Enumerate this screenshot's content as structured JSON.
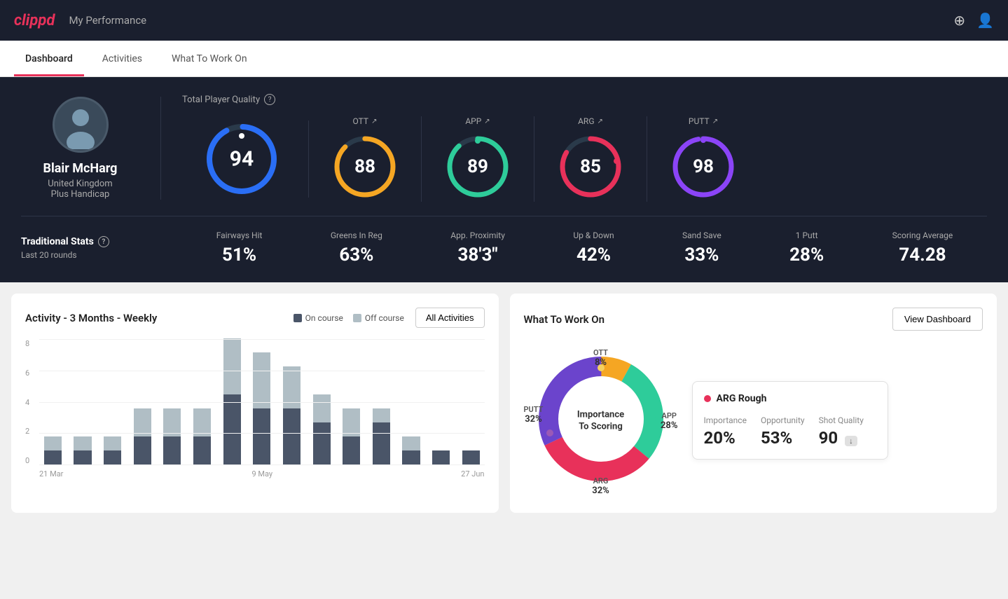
{
  "header": {
    "logo": "clippd",
    "title": "My Performance",
    "add_icon": "⊕",
    "user_icon": "👤"
  },
  "nav": {
    "tabs": [
      "Dashboard",
      "Activities",
      "What To Work On"
    ],
    "active": 0
  },
  "player": {
    "name": "Blair McHarg",
    "country": "United Kingdom",
    "handicap": "Plus Handicap"
  },
  "quality": {
    "label": "Total Player Quality",
    "main": {
      "value": "94"
    },
    "metrics": [
      {
        "id": "ott",
        "label": "OTT",
        "value": "88",
        "color": "#f5a623"
      },
      {
        "id": "app",
        "label": "APP",
        "value": "89",
        "color": "#2ecc9a"
      },
      {
        "id": "arg",
        "label": "ARG",
        "value": "85",
        "color": "#e8315a"
      },
      {
        "id": "putt",
        "label": "PUTT",
        "value": "98",
        "color": "#8b44f7"
      }
    ]
  },
  "traditional_stats": {
    "title": "Traditional Stats",
    "subtitle": "Last 20 rounds",
    "items": [
      {
        "label": "Fairways Hit",
        "value": "51%"
      },
      {
        "label": "Greens In Reg",
        "value": "63%"
      },
      {
        "label": "App. Proximity",
        "value": "38'3\""
      },
      {
        "label": "Up & Down",
        "value": "42%"
      },
      {
        "label": "Sand Save",
        "value": "33%"
      },
      {
        "label": "1 Putt",
        "value": "28%"
      },
      {
        "label": "Scoring Average",
        "value": "74.28"
      }
    ]
  },
  "activity_chart": {
    "title": "Activity - 3 Months - Weekly",
    "legend": {
      "on_course": "On course",
      "off_course": "Off course"
    },
    "button_label": "All Activities",
    "x_labels": [
      "21 Mar",
      "9 May",
      "27 Jun"
    ],
    "y_labels": [
      "0",
      "2",
      "4",
      "6",
      "8"
    ],
    "bars": [
      {
        "on": 1,
        "off": 1
      },
      {
        "on": 1,
        "off": 1
      },
      {
        "on": 1,
        "off": 1
      },
      {
        "on": 2,
        "off": 2
      },
      {
        "on": 2,
        "off": 2
      },
      {
        "on": 2,
        "off": 2
      },
      {
        "on": 5,
        "off": 4
      },
      {
        "on": 4,
        "off": 4
      },
      {
        "on": 4,
        "off": 3
      },
      {
        "on": 3,
        "off": 2
      },
      {
        "on": 2,
        "off": 2
      },
      {
        "on": 3,
        "off": 1
      },
      {
        "on": 1,
        "off": 1
      },
      {
        "on": 1,
        "off": 0
      },
      {
        "on": 1,
        "off": 0
      }
    ]
  },
  "work_on": {
    "title": "What To Work On",
    "button_label": "View Dashboard",
    "donut_center_line1": "Importance",
    "donut_center_line2": "To Scoring",
    "segments": [
      {
        "id": "ott",
        "label": "OTT",
        "value": "8%",
        "color": "#f5a623",
        "position": {
          "top": "8%",
          "left": "50%"
        }
      },
      {
        "id": "app",
        "label": "APP",
        "value": "28%",
        "color": "#2ecc9a",
        "position": {
          "top": "50%",
          "right": "2%"
        }
      },
      {
        "id": "arg",
        "label": "ARG",
        "value": "32%",
        "color": "#e8315a",
        "position": {
          "bottom": "5%",
          "left": "43%"
        }
      },
      {
        "id": "putt",
        "label": "PUTT",
        "value": "32%",
        "color": "#8b44f7",
        "position": {
          "top": "42%",
          "left": "2%"
        }
      }
    ],
    "info_card": {
      "title": "ARG Rough",
      "dot_color": "#e8315a",
      "stats": [
        {
          "label": "Importance",
          "value": "20%"
        },
        {
          "label": "Opportunity",
          "value": "53%"
        },
        {
          "label": "Shot Quality",
          "value": "90",
          "badge": "↓"
        }
      ]
    }
  }
}
